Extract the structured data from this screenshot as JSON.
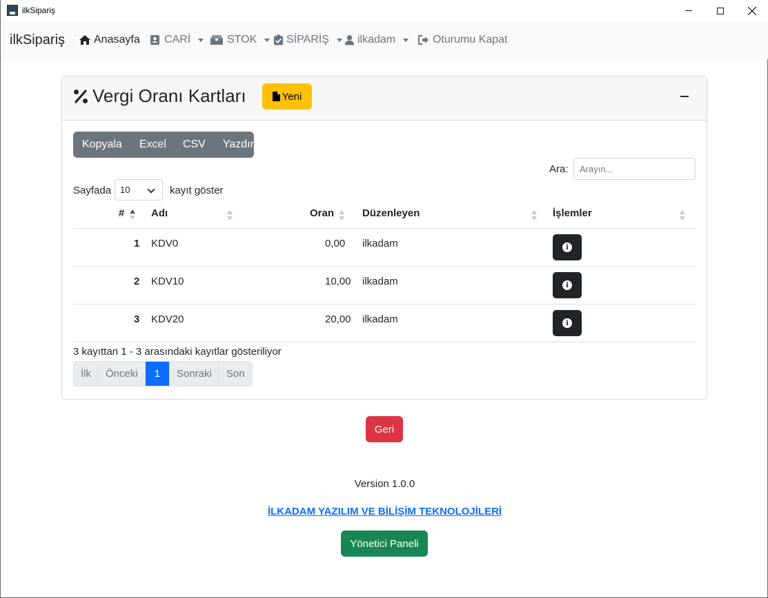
{
  "window": {
    "title": "ilkSipariş"
  },
  "navbar": {
    "brand": "ilkSipariş",
    "items": [
      {
        "label": "Anasayfa",
        "icon": "home-icon"
      },
      {
        "label": "CARİ",
        "icon": "address-card-icon"
      },
      {
        "label": "STOK",
        "icon": "boxes-icon"
      },
      {
        "label": "SİPARİŞ",
        "icon": "clipboard-check-icon"
      },
      {
        "label": "ilkadam",
        "icon": "user-icon"
      },
      {
        "label": "Oturumu Kapat",
        "icon": "sign-out-icon"
      }
    ]
  },
  "card": {
    "title": "Vergi Oranı Kartları",
    "new_button": "Yeni"
  },
  "toolbar": {
    "buttons": [
      "Kopyala",
      "Excel",
      "CSV",
      "Yazdır"
    ]
  },
  "search": {
    "label": "Ara:",
    "placeholder": "Arayın..."
  },
  "length": {
    "prefix": "Sayfada",
    "value": "10",
    "suffix": "kayıt göster"
  },
  "table": {
    "headers": [
      "#",
      "Adı",
      "Oran",
      "Düzenleyen",
      "İşlemler"
    ],
    "rows": [
      {
        "no": "1",
        "name": "KDV0",
        "rate": "0,00",
        "editor": "ilkadam"
      },
      {
        "no": "2",
        "name": "KDV10",
        "rate": "10,00",
        "editor": "ilkadam"
      },
      {
        "no": "3",
        "name": "KDV20",
        "rate": "20,00",
        "editor": "ilkadam"
      }
    ]
  },
  "info": "3 kayıttan 1 - 3 arasındaki kayıtlar gösteriliyor",
  "pagination": {
    "first": "İlk",
    "prev": "Önceki",
    "current": "1",
    "next": "Sonraki",
    "last": "Son"
  },
  "back_button": "Geri",
  "footer": {
    "version": "Version 1.0.0",
    "company": "İLKADAM YAZILIM VE BİLİŞİM TEKNOLOJİLERİ",
    "admin_button": "Yönetici Paneli"
  },
  "colors": {
    "warning": "#ffc107",
    "danger": "#dc3545",
    "success": "#198754",
    "primary": "#0d6efd",
    "secondary": "#6c757d",
    "dark": "#212529"
  }
}
